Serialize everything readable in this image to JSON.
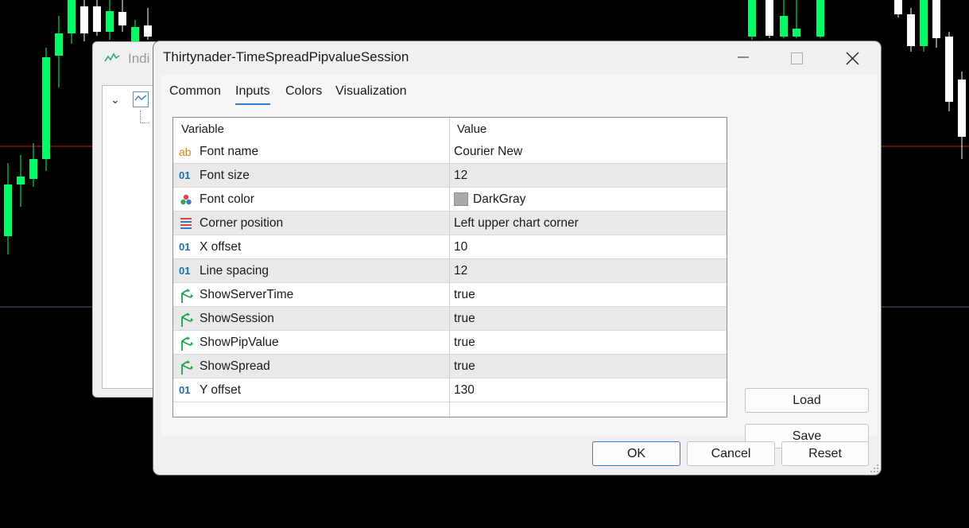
{
  "background_window": {
    "title": "Indi"
  },
  "dialog": {
    "title": "Thirtynader-TimeSpreadPipvalueSession",
    "tabs": [
      {
        "label": "Common",
        "active": false
      },
      {
        "label": "Inputs",
        "active": true
      },
      {
        "label": "Colors",
        "active": false
      },
      {
        "label": "Visualization",
        "active": false
      }
    ],
    "grid": {
      "headers": {
        "variable": "Variable",
        "value": "Value"
      },
      "rows": [
        {
          "icon": "string-icon",
          "name": "Font name",
          "value": "Courier New"
        },
        {
          "icon": "integer-icon",
          "name": "Font size",
          "value": "12"
        },
        {
          "icon": "color-icon",
          "name": "Font color",
          "value": "DarkGray",
          "swatch": "#A9A9A9"
        },
        {
          "icon": "enum-icon",
          "name": "Corner position",
          "value": "Left upper chart corner"
        },
        {
          "icon": "integer-icon",
          "name": "X offset",
          "value": "10"
        },
        {
          "icon": "integer-icon",
          "name": "Line spacing",
          "value": "12"
        },
        {
          "icon": "bool-icon",
          "name": "ShowServerTime",
          "value": "true"
        },
        {
          "icon": "bool-icon",
          "name": "ShowSession",
          "value": "true"
        },
        {
          "icon": "bool-icon",
          "name": "ShowPipValue",
          "value": "true"
        },
        {
          "icon": "bool-icon",
          "name": "ShowSpread",
          "value": "true"
        },
        {
          "icon": "integer-icon",
          "name": "Y offset",
          "value": "130"
        }
      ]
    },
    "side_buttons": {
      "load": "Load",
      "save": "Save"
    },
    "footer_buttons": {
      "ok": "OK",
      "cancel": "Cancel",
      "reset": "Reset"
    }
  },
  "colors": {
    "accent": "#2F7BD6",
    "bull_candle": "#00FF66",
    "bear_candle": "#FFFFFF",
    "chart_background": "#000000",
    "price_line": "#FF0000"
  }
}
